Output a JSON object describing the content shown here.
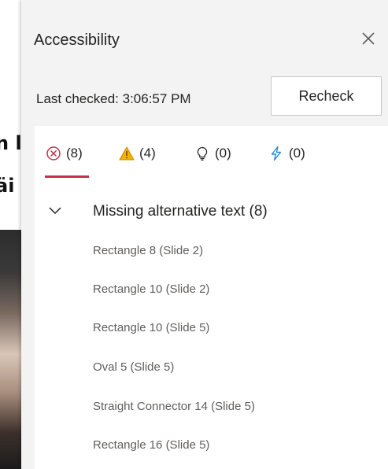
{
  "background": {
    "line1": "n l",
    "line2": "äi"
  },
  "pane": {
    "title": "Accessibility",
    "close_label": "×",
    "last_checked": "Last checked: 3:06:57 PM",
    "recheck_label": "Recheck",
    "tabs": [
      {
        "icon": "error-circle-icon",
        "count": "(8)",
        "color": "#c4314b"
      },
      {
        "icon": "warning-icon",
        "count": "(4)",
        "color": "#e8a000"
      },
      {
        "icon": "lightbulb-icon",
        "count": "(0)",
        "color": "#252423"
      },
      {
        "icon": "lightning-icon",
        "count": "(0)",
        "color": "#2b88d8"
      }
    ],
    "group": {
      "title": "Missing alternative text (8)",
      "expanded": true
    },
    "issues": [
      "Rectangle 8 (Slide 2)",
      "Rectangle 10 (Slide 2)",
      "Rectangle 10 (Slide 5)",
      "Oval 5 (Slide 5)",
      "Straight Connector 14 (Slide 5)",
      "Rectangle 16 (Slide 5)"
    ]
  },
  "colors": {
    "error_accent": "#c4314b",
    "pane_background": "#f3f3f3",
    "content_background": "#ffffff"
  }
}
